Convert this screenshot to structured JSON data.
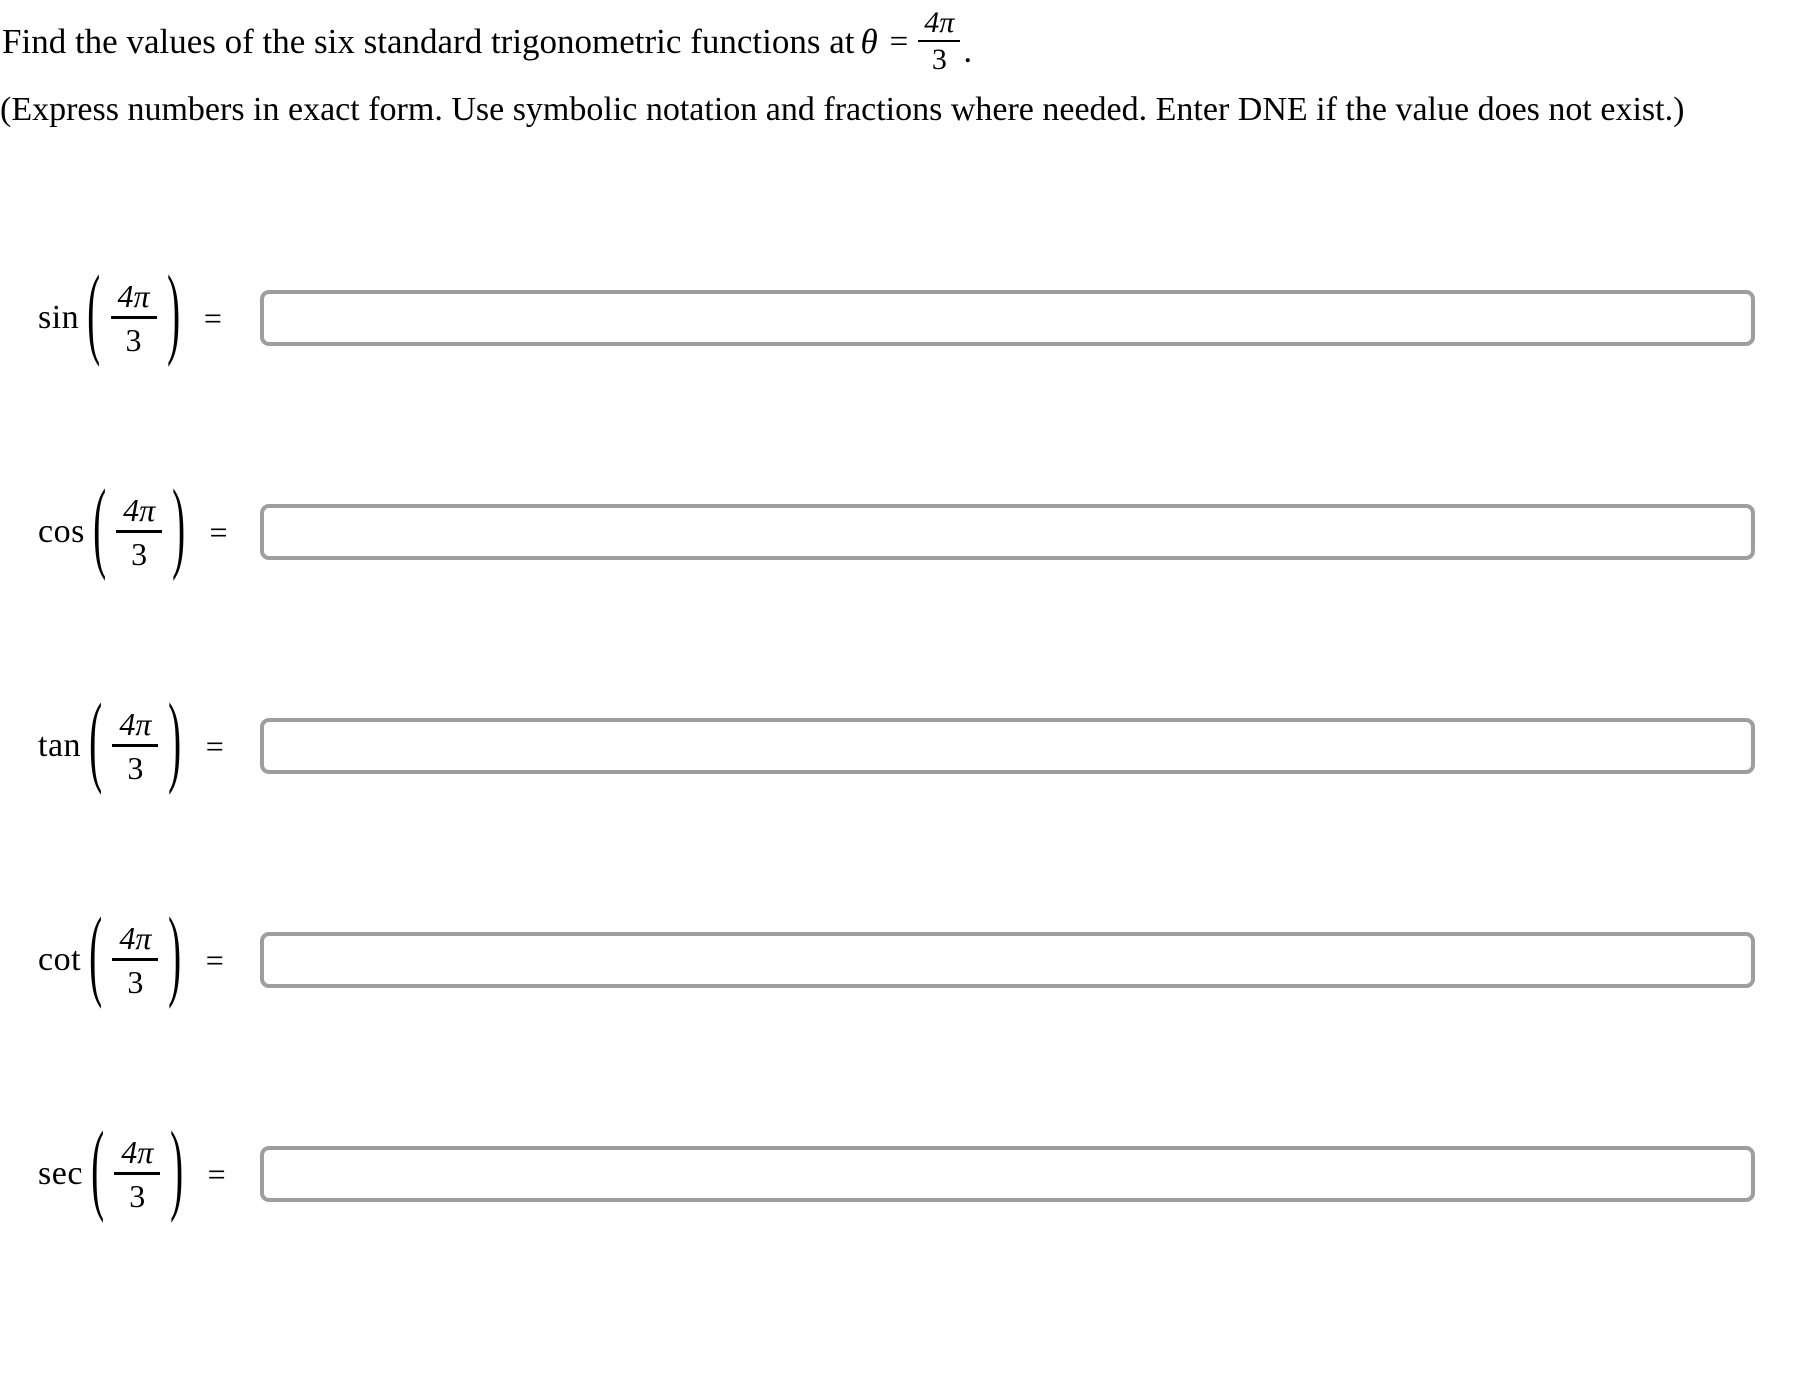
{
  "problem": {
    "question_prefix": "Find the values of the six standard trigonometric functions at",
    "variable": "θ",
    "equals": "=",
    "angle_numerator": "4π",
    "angle_denominator": "3",
    "period": ".",
    "instruction": "(Express numbers in exact form. Use symbolic notation and fractions where needed. Enter DNE if the value does not exist.)"
  },
  "style": {
    "input_border_color": "#9e9e9e",
    "text_color": "#000000",
    "background_color": "#ffffff"
  },
  "rows": [
    {
      "function": "sin",
      "open_paren": "(",
      "numerator": "4π",
      "denominator": "3",
      "close_paren": ")",
      "equals": "=",
      "value": "",
      "placeholder": ""
    },
    {
      "function": "cos",
      "open_paren": "(",
      "numerator": "4π",
      "denominator": "3",
      "close_paren": ")",
      "equals": "=",
      "value": "",
      "placeholder": ""
    },
    {
      "function": "tan",
      "open_paren": "(",
      "numerator": "4π",
      "denominator": "3",
      "close_paren": ")",
      "equals": "=",
      "value": "",
      "placeholder": ""
    },
    {
      "function": "cot",
      "open_paren": "(",
      "numerator": "4π",
      "denominator": "3",
      "close_paren": ")",
      "equals": "=",
      "value": "",
      "placeholder": ""
    },
    {
      "function": "sec",
      "open_paren": "(",
      "numerator": "4π",
      "denominator": "3",
      "close_paren": ")",
      "equals": "=",
      "value": "",
      "placeholder": ""
    }
  ]
}
